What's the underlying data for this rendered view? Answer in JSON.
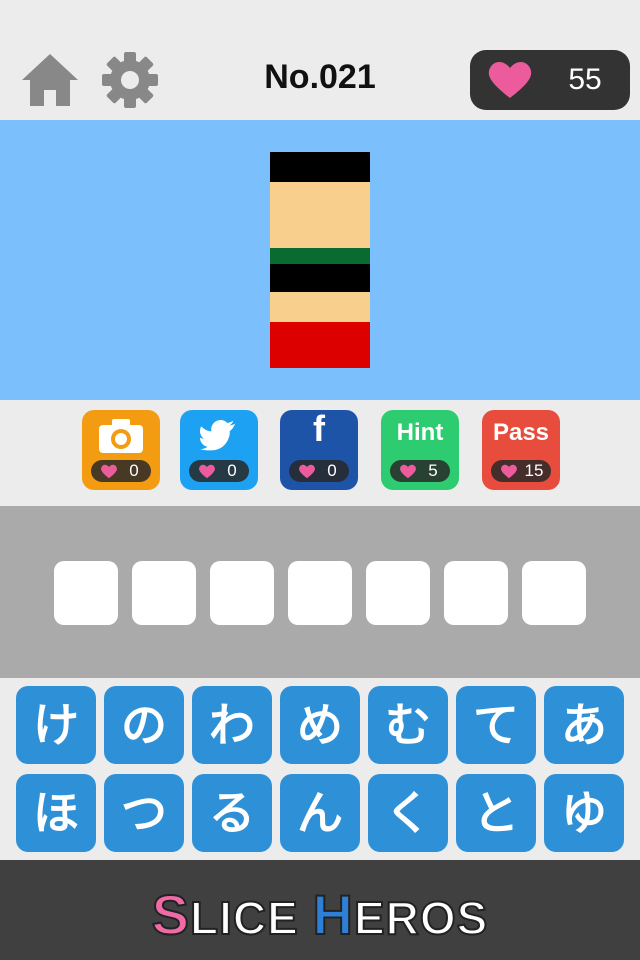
{
  "header": {
    "level_title": "No.021",
    "hearts": "55",
    "home_icon": "home-icon",
    "settings_icon": "gear-icon",
    "heart_color": "#ec5c9c"
  },
  "puzzle": {
    "background": "#7bc0fc",
    "stripes": [
      "#000000",
      "#f9cf8e",
      "#0a6b30",
      "#000000",
      "#f9cf8e",
      "#dd0000"
    ]
  },
  "actions": [
    {
      "name": "camera",
      "icon": "camera-icon",
      "label": "",
      "cost": "0",
      "color": "#f39c12"
    },
    {
      "name": "twitter",
      "icon": "twitter-bird-icon",
      "label": "",
      "cost": "0",
      "color": "#1da1f2"
    },
    {
      "name": "facebook",
      "icon": "facebook-f-icon",
      "label": "f",
      "cost": "0",
      "color": "#1d54a8"
    },
    {
      "name": "hint",
      "icon": "",
      "label": "Hint",
      "cost": "5",
      "color": "#2ecc71"
    },
    {
      "name": "pass",
      "icon": "",
      "label": "Pass",
      "cost": "15",
      "color": "#e74c3c"
    }
  ],
  "answer_slots": 7,
  "keyboard": {
    "row1": [
      "け",
      "の",
      "わ",
      "め",
      "む",
      "て",
      "あ"
    ],
    "row2": [
      "ほ",
      "つ",
      "る",
      "ん",
      "く",
      "と",
      "ゆ"
    ]
  },
  "footer": {
    "brand_part1": "S",
    "brand_part2": "LICE ",
    "brand_part3": "H",
    "brand_part4": "EROS",
    "accent_pink": "#f06aa8",
    "accent_blue": "#2e7fd8"
  }
}
